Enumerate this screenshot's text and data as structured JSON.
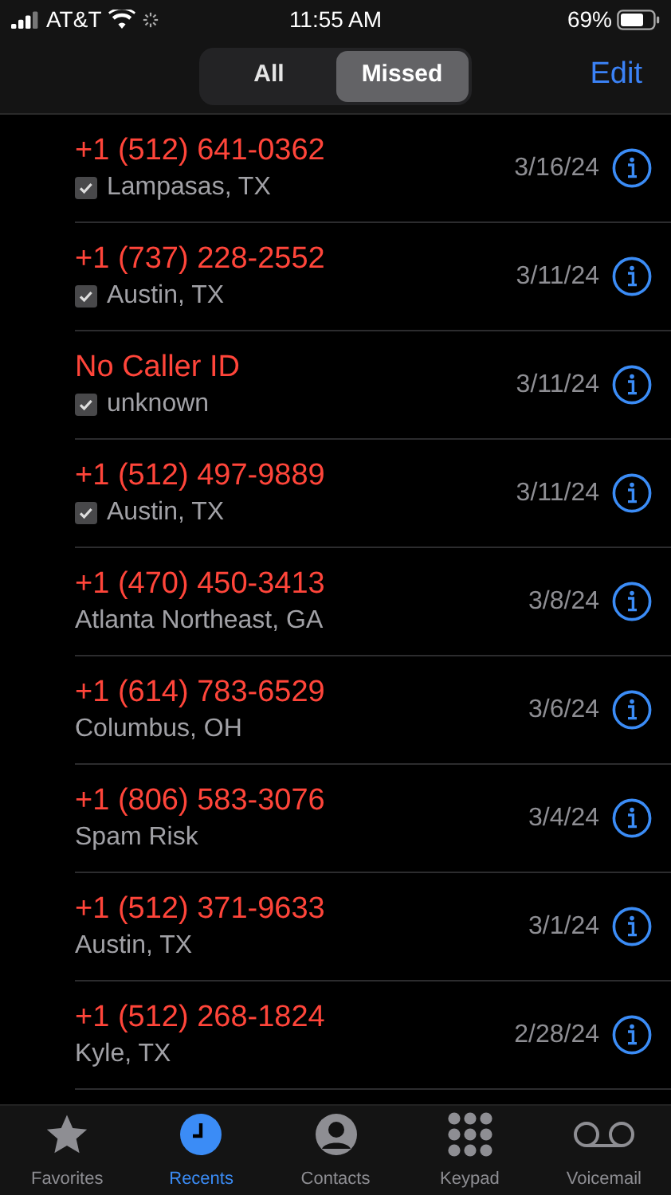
{
  "status_bar": {
    "carrier": "AT&T",
    "time": "11:55 AM",
    "battery": "69%"
  },
  "segments": [
    {
      "label": "All",
      "selected": false
    },
    {
      "label": "Missed",
      "selected": true
    }
  ],
  "edit_button": "Edit",
  "calls": [
    {
      "caller": "+1 (512) 641-0362",
      "location": "Lampasas, TX",
      "verified": true,
      "date": "3/16/24"
    },
    {
      "caller": "+1 (737) 228-2552",
      "location": "Austin, TX",
      "verified": true,
      "date": "3/11/24"
    },
    {
      "caller": "No Caller ID",
      "location": "unknown",
      "verified": true,
      "date": "3/11/24"
    },
    {
      "caller": "+1 (512) 497-9889",
      "location": "Austin, TX",
      "verified": true,
      "date": "3/11/24"
    },
    {
      "caller": "+1 (470) 450-3413",
      "location": "Atlanta Northeast, GA",
      "verified": false,
      "date": "3/8/24"
    },
    {
      "caller": "+1 (614) 783-6529",
      "location": "Columbus, OH",
      "verified": false,
      "date": "3/6/24"
    },
    {
      "caller": "+1 (806) 583-3076",
      "location": "Spam Risk",
      "verified": false,
      "date": "3/4/24"
    },
    {
      "caller": "+1 (512) 371-9633",
      "location": "Austin, TX",
      "verified": false,
      "date": "3/1/24"
    },
    {
      "caller": "+1 (512) 268-1824",
      "location": "Kyle, TX",
      "verified": false,
      "date": "2/28/24"
    }
  ],
  "tab_bar": [
    {
      "kind": "star",
      "label": "Favorites",
      "selected": false
    },
    {
      "kind": "clock",
      "label": "Recents",
      "selected": true
    },
    {
      "kind": "person",
      "label": "Contacts",
      "selected": false
    },
    {
      "kind": "keypad",
      "label": "Keypad",
      "selected": false
    },
    {
      "kind": "voicemail",
      "label": "Voicemail",
      "selected": false
    }
  ]
}
